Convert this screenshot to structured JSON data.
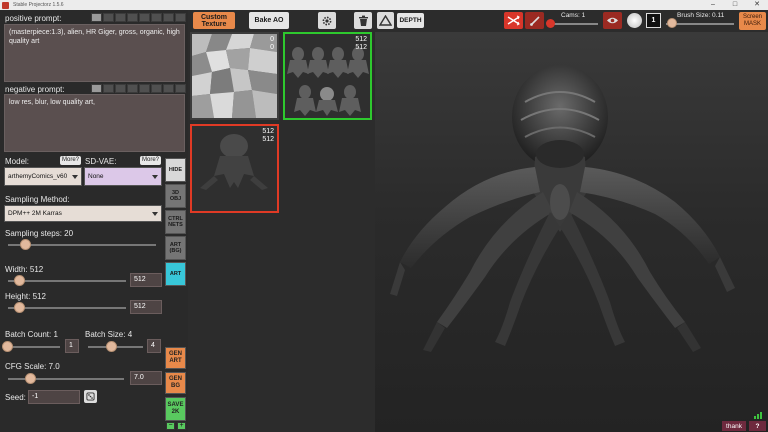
{
  "window": {
    "title": "Stable Projectorz 1.5.6"
  },
  "prompts": {
    "positive_label": "positive prompt:",
    "positive_text": "(masterpiece:1.3), alien, HR Giger, gross, organic, high quality art",
    "negative_label": "negative prompt:",
    "negative_text": "low res, blur, low quality art,"
  },
  "model": {
    "label": "Model:",
    "more": "More?",
    "value": "arthemyComics_v60"
  },
  "vae": {
    "label": "SD-VAE:",
    "more": "More?",
    "value": "None"
  },
  "sampling": {
    "label": "Sampling Method:",
    "value": "DPM++ 2M Karras"
  },
  "steps": {
    "label": "Sampling steps:  20",
    "value": 20
  },
  "width": {
    "label": "Width: 512",
    "value": "512"
  },
  "height": {
    "label": "Height: 512",
    "value": "512"
  },
  "batch_count": {
    "label": "Batch Count: 1",
    "value": "1"
  },
  "batch_size": {
    "label": "Batch Size: 4",
    "value": "4"
  },
  "cfg": {
    "label": "CFG Scale: 7.0",
    "value": "7.0"
  },
  "seed": {
    "label": "Seed:",
    "value": "-1"
  },
  "side_tabs": {
    "hide": "HIDE",
    "obj": "3D OBJ",
    "ctrl": "CTRL NETS",
    "art_bg": "ART (BG)",
    "art": "ART"
  },
  "gen_buttons": {
    "gen_art": "GEN ART",
    "gen_bg": "GEN BG",
    "save": "SAVE 2K"
  },
  "toolbar": {
    "custom_texture": "Custom Texture",
    "bake_ao": "Bake AO",
    "depth": "DEPTH"
  },
  "thumbs": [
    {
      "w": "0",
      "h": "0"
    },
    {
      "w": "512",
      "h": "512"
    },
    {
      "w": "512",
      "h": "512"
    }
  ],
  "viewport": {
    "cams": "Cams: 1",
    "cam_index": "1",
    "brush_index": "1",
    "brush_size": "Brush Size: 0.11",
    "screen_mask": "Screen MASK",
    "thank": "thank",
    "q": "?"
  },
  "colors": {
    "accent_orange": "#e8894a",
    "active_cyan": "#38c7d9",
    "green_select": "#2ec92e",
    "red_select": "#e03a25"
  }
}
